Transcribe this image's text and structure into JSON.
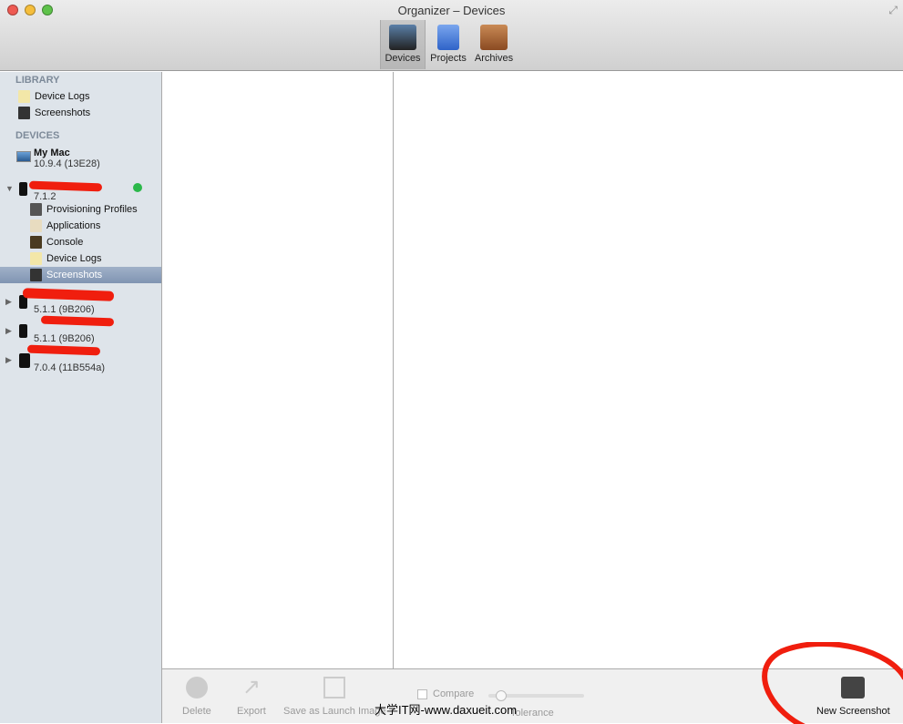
{
  "window": {
    "title": "Organizer – Devices"
  },
  "toolbar": {
    "items": [
      {
        "label": "Devices",
        "icon": "devices-icon",
        "selected": true
      },
      {
        "label": "Projects",
        "icon": "projects-icon"
      },
      {
        "label": "Archives",
        "icon": "archives-icon"
      }
    ]
  },
  "sidebar": {
    "library_header": "LIBRARY",
    "library": [
      {
        "label": "Device Logs",
        "icon": "warning-log-icon"
      },
      {
        "label": "Screenshots",
        "icon": "screenshot-icon"
      }
    ],
    "devices_header": "DEVICES",
    "devices": [
      {
        "name": "My Mac",
        "version": "10.9.4 (13E28)"
      },
      {
        "name": "",
        "version": "7.1.2",
        "expanded": true,
        "status_color": "#2bb84a",
        "children": [
          {
            "label": "Provisioning Profiles"
          },
          {
            "label": "Applications"
          },
          {
            "label": "Console"
          },
          {
            "label": "Device Logs"
          },
          {
            "label": "Screenshots",
            "selected": true
          }
        ]
      },
      {
        "name": "",
        "version": "5.1.1 (9B206)"
      },
      {
        "name": "",
        "version": "5.1.1 (9B206)"
      },
      {
        "name": "",
        "version": "7.0.4 (11B554a)"
      }
    ]
  },
  "bottom_bar": {
    "delete": "Delete",
    "export": "Export",
    "save_launch": "Save as Launch Image",
    "compare": "Compare",
    "compare_checked": false,
    "tolerance": "Tolerance",
    "tolerance_value": 0.1,
    "new_screenshot": "New Screenshot"
  },
  "watermark": "大学IT网-www.daxueit.com"
}
